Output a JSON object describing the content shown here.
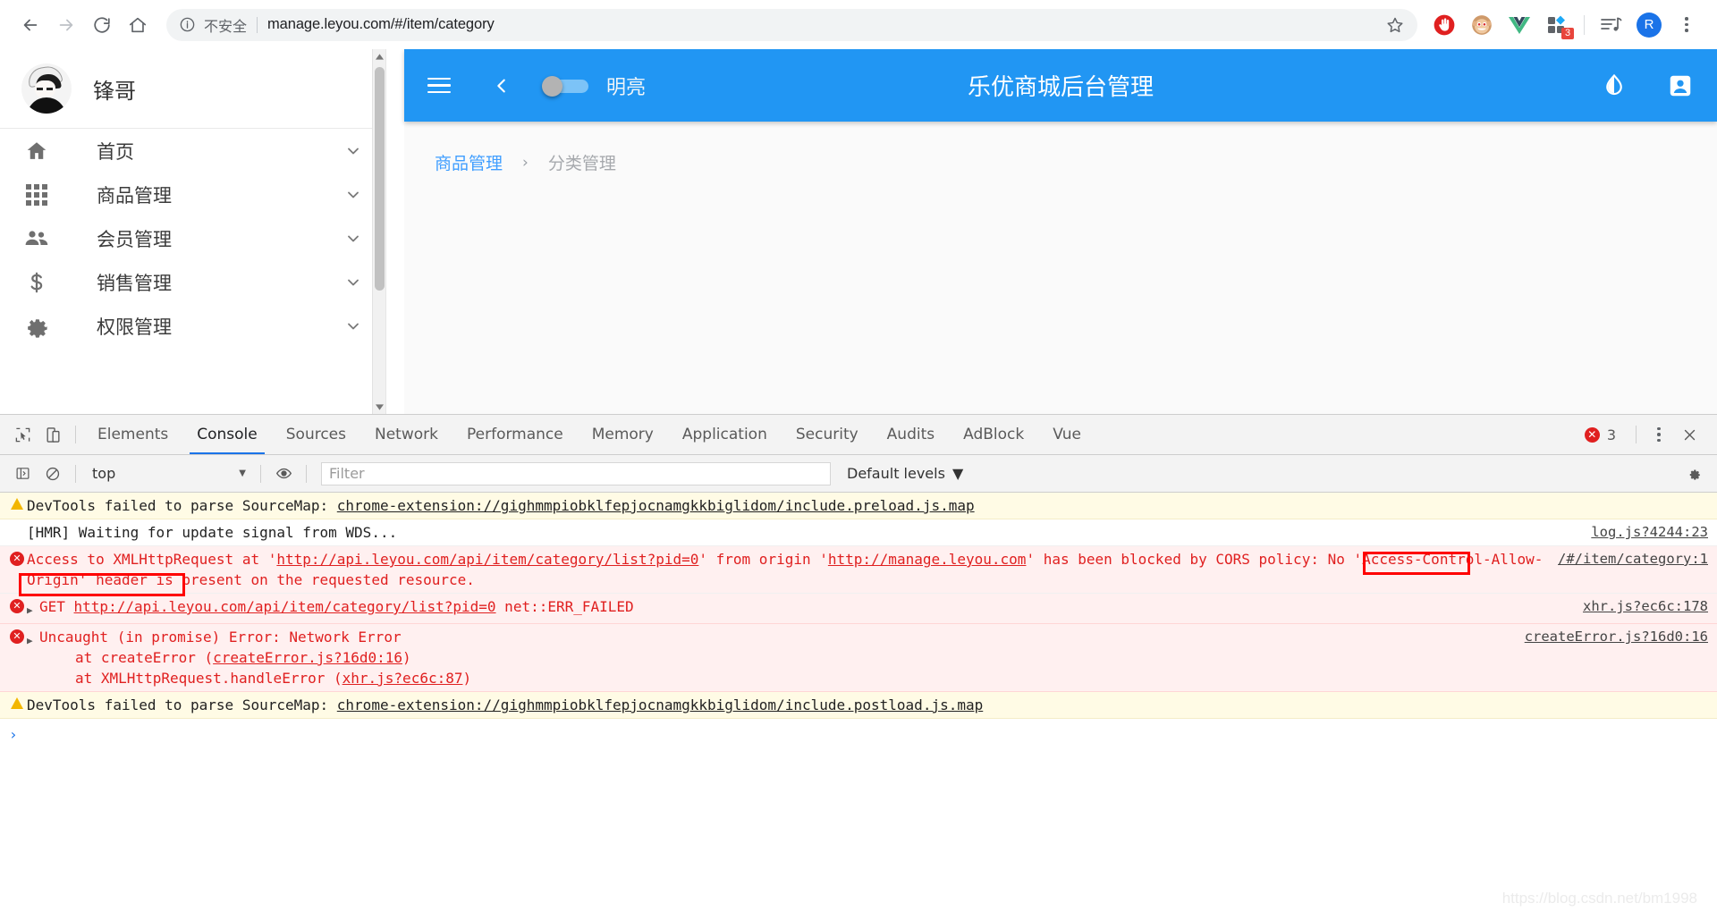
{
  "browser": {
    "back_icon": "arrow-left-icon",
    "forward_icon": "arrow-right-icon",
    "reload_icon": "reload-icon",
    "home_icon": "home-icon",
    "info_icon": "info-circle-icon",
    "not_secure_label": "不安全",
    "url": "manage.leyou.com/#/item/category",
    "bookmark_icon": "star-icon",
    "extensions": [
      {
        "name": "adblock-icon",
        "label": "AdBlock"
      },
      {
        "name": "tampermonkey-icon",
        "label": "Tampermonkey"
      },
      {
        "name": "vue-devtools-icon",
        "label": "Vue.js devtools"
      },
      {
        "name": "extensions-puzzle-icon",
        "label": "Extensions",
        "badge": "3"
      },
      {
        "name": "media-playlist-icon",
        "label": "Media"
      }
    ],
    "profile_initial": "R",
    "menu_icon": "kebab-menu-icon"
  },
  "sidebar": {
    "user_name": "锋哥",
    "avatar_icon": "user-avatar",
    "items": [
      {
        "icon": "home-icon",
        "label": "首页",
        "chevron": "chevron-down-icon"
      },
      {
        "icon": "grid-icon",
        "label": "商品管理",
        "chevron": "chevron-down-icon"
      },
      {
        "icon": "people-icon",
        "label": "会员管理",
        "chevron": "chevron-down-icon"
      },
      {
        "icon": "dollar-icon",
        "label": "销售管理",
        "chevron": "chevron-down-icon"
      },
      {
        "icon": "gear-icon",
        "label": "权限管理",
        "chevron": "chevron-down-icon"
      }
    ]
  },
  "app": {
    "menu_icon": "hamburger-icon",
    "back_icon": "chevron-left-icon",
    "theme_switch_label": "明亮",
    "theme_switch_on": false,
    "title": "乐优商城后台管理",
    "contrast_icon": "theme-droplet-icon",
    "account_icon": "account-box-icon",
    "header_color": "#2196f3",
    "breadcrumb": {
      "parent": "商品管理",
      "separator": "›",
      "current": "分类管理"
    }
  },
  "devtools": {
    "inspect_icon": "inspect-element-icon",
    "device_icon": "device-toolbar-icon",
    "tabs": [
      "Elements",
      "Console",
      "Sources",
      "Network",
      "Performance",
      "Memory",
      "Application",
      "Security",
      "Audits",
      "AdBlock",
      "Vue"
    ],
    "active_tab": "Console",
    "error_count": "3",
    "error_icon": "error-circle-icon",
    "more_icon": "kebab-menu-icon",
    "close_icon": "close-icon",
    "toolbar": {
      "sidebar_icon": "console-sidebar-icon",
      "clear_icon": "clear-console-icon",
      "context": "top",
      "context_caret": "▼",
      "eye_icon": "live-expression-icon",
      "filter_placeholder": "Filter",
      "levels_label": "Default levels",
      "levels_caret": "▼",
      "settings_icon": "gear-icon"
    },
    "messages": [
      {
        "type": "warning",
        "icon": "warning-triangle-icon",
        "text": "DevTools failed to parse SourceMap: ",
        "link": "chrome-extension://gighmmpiobklfepjocnamgkkbiglidom/include.preload.js.map",
        "source": ""
      },
      {
        "type": "info",
        "icon": "",
        "text": "[HMR] Waiting for update signal from WDS...",
        "link": "",
        "source": "log.js?4244:23"
      },
      {
        "type": "error",
        "icon": "error-circle-icon",
        "text_1": "Access to XMLHttpRequest at '",
        "link_1": "http://api.leyou.com/api/item/category/list?pid=0",
        "text_2": "' from origin '",
        "link_2": "http://manage.leyou.com",
        "text_3": "' has been blocked by CORS policy: No 'Access-Control-Allow-Origin' header is present on the requested resource.",
        "source": "/#/item/category:1"
      },
      {
        "type": "error",
        "icon": "error-circle-icon",
        "expander": "▶",
        "text_1": "GET ",
        "link_1": "http://api.leyou.com/api/item/category/list?pid=0",
        "text_2": " net::ERR_FAILED",
        "source": "xhr.js?ec6c:178"
      },
      {
        "type": "error",
        "icon": "error-circle-icon",
        "expander": "▶",
        "text": "Uncaught (in promise) Error: Network Error",
        "stack": [
          {
            "prefix": "    at createError (",
            "link": "createError.js?16d0:16",
            "suffix": ")"
          },
          {
            "prefix": "    at XMLHttpRequest.handleError (",
            "link": "xhr.js?ec6c:87",
            "suffix": ")"
          }
        ],
        "source": "createError.js?16d0:16"
      },
      {
        "type": "warning",
        "icon": "warning-triangle-icon",
        "text": "DevTools failed to parse SourceMap: ",
        "link": "chrome-extension://gighmmpiobklfepjocnamgkkbiglidom/include.postload.js.map",
        "source": ""
      }
    ],
    "prompt_caret": "›"
  },
  "annotations": {
    "color": "#ff0000",
    "boxes": [
      "No 'Access-",
      "Control-Allow-Origin'"
    ]
  },
  "watermark": "https://blog.csdn.net/bm1998"
}
